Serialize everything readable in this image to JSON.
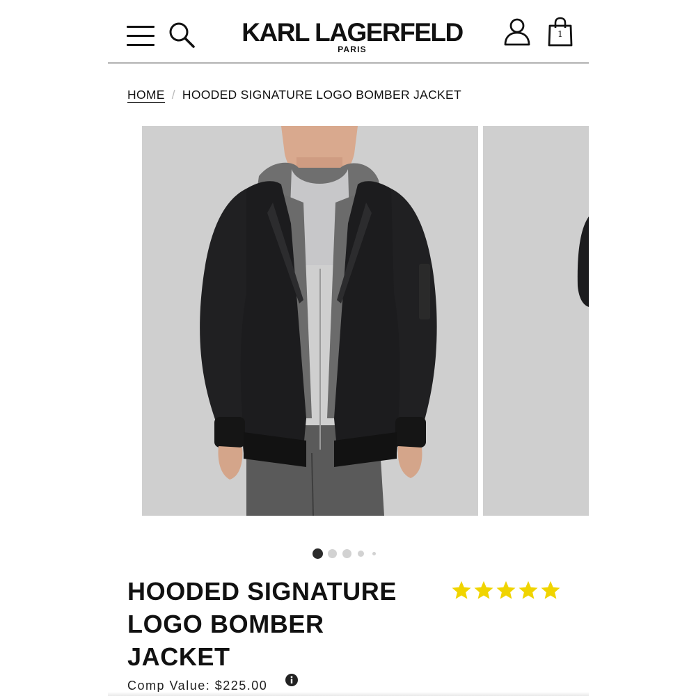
{
  "header": {
    "brand_main": "KARL LAGERFELD",
    "brand_sub": "PARIS",
    "cart_count": "1",
    "icons": [
      "menu-icon",
      "search-icon",
      "account-icon",
      "shopping-bag-icon"
    ]
  },
  "breadcrumb": {
    "home": "HOME",
    "separator": "/",
    "current": "HOODED SIGNATURE LOGO BOMBER JACKET"
  },
  "gallery": {
    "images": [
      "Model wearing black hooded bomber jacket with grey hood, grey sweater and grey jeans on light grey background",
      "Black bomber jacket on light grey background"
    ],
    "dots": {
      "count": 5,
      "active_index": 0
    },
    "background_color": "#cfcfcf"
  },
  "product": {
    "title_lines": [
      "HOODED SIGNATURE",
      "LOGO BOMBER",
      "JACKET"
    ],
    "rating": 5,
    "rating_max": 5,
    "star_color": "#f0d400",
    "comp_value_text": "Comp Value: $225.00"
  }
}
